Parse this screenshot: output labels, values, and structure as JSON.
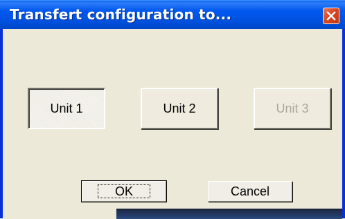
{
  "dialog": {
    "title": "Transfert configuration to..."
  },
  "units": [
    {
      "label": "Unit 1",
      "state": "pressed"
    },
    {
      "label": "Unit 2",
      "state": "normal"
    },
    {
      "label": "Unit 3",
      "state": "disabled"
    }
  ],
  "actions": {
    "ok_label": "OK",
    "cancel_label": "Cancel"
  },
  "colors": {
    "titlebar": "#0054e3",
    "dialog_bg": "#ece9d8",
    "close_button": "#d9461f",
    "disabled_text": "#aca899"
  }
}
